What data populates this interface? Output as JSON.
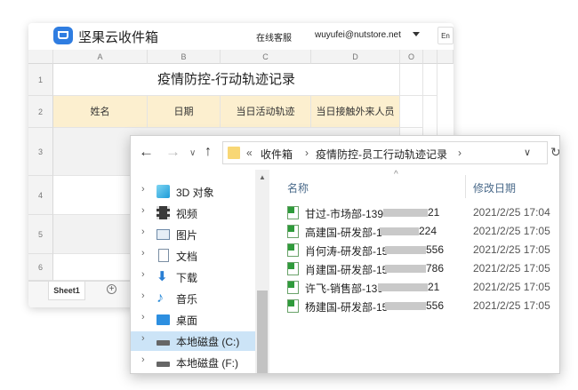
{
  "app": {
    "title": "坚果云收件箱",
    "support_link": "在线客服",
    "user_email": "wuyufei@nutstore.net",
    "language_button": "En"
  },
  "sheet": {
    "columns": [
      "A",
      "B",
      "C",
      "D",
      "O"
    ],
    "rows": [
      "1",
      "2",
      "3",
      "4",
      "5",
      "6"
    ],
    "title": "疫情防控-行动轨迹记录",
    "headers": [
      "姓名",
      "日期",
      "当日活动轨迹",
      "当日接触外来人员"
    ],
    "tab_name": "Sheet1",
    "add_tab_icon": "+"
  },
  "explorer": {
    "nav": {
      "back": "←",
      "forward": "→",
      "up": "↑",
      "refresh": "↻"
    },
    "breadcrumb": [
      "«",
      "收件箱",
      "›",
      "疫情防控-员工行动轨迹记录",
      "›"
    ],
    "dropdown_icon": "∨",
    "nav_pane": [
      {
        "label": "3D 对象",
        "icon": "cube-3d-icon",
        "selected": false
      },
      {
        "label": "视频",
        "icon": "video-icon",
        "selected": false
      },
      {
        "label": "图片",
        "icon": "picture-icon",
        "selected": false
      },
      {
        "label": "文档",
        "icon": "document-icon",
        "selected": false
      },
      {
        "label": "下载",
        "icon": "download-icon",
        "selected": false
      },
      {
        "label": "音乐",
        "icon": "music-icon",
        "selected": false
      },
      {
        "label": "桌面",
        "icon": "desktop-icon",
        "selected": false
      },
      {
        "label": "本地磁盘 (C:)",
        "icon": "drive-icon",
        "selected": true
      },
      {
        "label": "本地磁盘 (F:)",
        "icon": "drive-icon",
        "selected": false
      }
    ],
    "columns": {
      "name": "名称",
      "date": "修改日期"
    },
    "files": [
      {
        "name": "甘过-市场部-139",
        "tail": "21",
        "date": "2021/2/25 17:04"
      },
      {
        "name": "高建国-研发部-1",
        "tail": "224",
        "date": "2021/2/25 17:05"
      },
      {
        "name": "肖何涛-研发部-15",
        "tail": "556",
        "date": "2021/2/25 17:05"
      },
      {
        "name": "肖建国-研发部-15",
        "tail": "786",
        "date": "2021/2/25 17:05"
      },
      {
        "name": "许飞-销售部-139",
        "tail": "21",
        "date": "2021/2/25 17:05"
      },
      {
        "name": "杨建国-研发部-15",
        "tail": "556",
        "date": "2021/2/25 17:05"
      }
    ]
  },
  "colors": {
    "header_fill": "#fcefcf",
    "selected_nav": "#cce4f7",
    "excel_icon": "#2e9b3b",
    "accent": "#2f7de1"
  }
}
